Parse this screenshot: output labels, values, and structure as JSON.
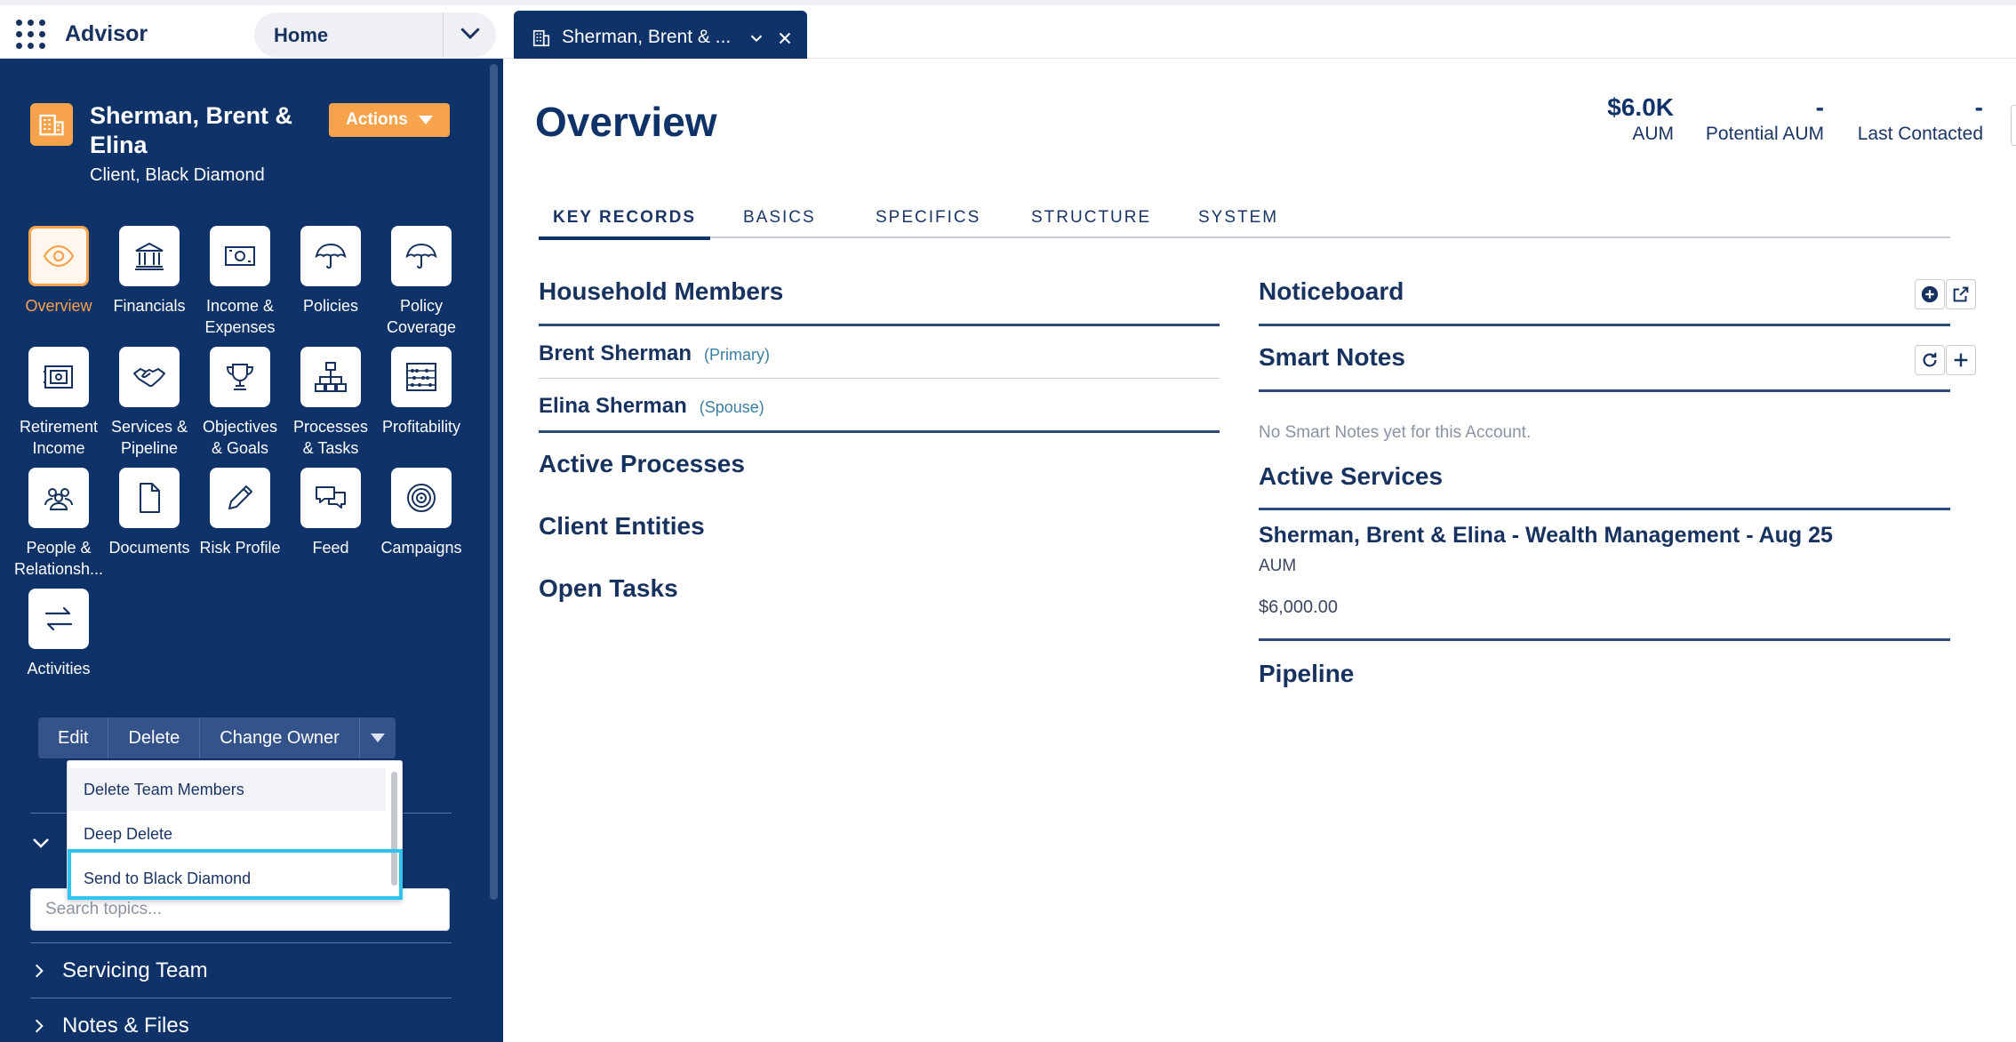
{
  "topbar": {
    "app_name": "Advisor",
    "nav_select": "Home",
    "open_tab": "Sherman, Brent & ..."
  },
  "sidebar": {
    "account_name": "Sherman, Brent & Elina",
    "account_subtitle": "Client, Black Diamond",
    "actions_label": "Actions",
    "tiles": [
      {
        "label": "Overview",
        "icon": "eye-icon"
      },
      {
        "label": "Financials",
        "icon": "bank-icon"
      },
      {
        "label": "Income &\nExpenses",
        "icon": "banknote-icon"
      },
      {
        "label": "Policies",
        "icon": "umbrella-icon"
      },
      {
        "label": "Policy\nCoverage",
        "icon": "umbrella-icon"
      },
      {
        "label": "Retirement\nIncome",
        "icon": "safe-icon"
      },
      {
        "label": "Services &\nPipeline",
        "icon": "handshake-icon"
      },
      {
        "label": "Objectives\n& Goals",
        "icon": "trophy-icon"
      },
      {
        "label": "Processes\n& Tasks",
        "icon": "org-chart-icon"
      },
      {
        "label": "Profitability",
        "icon": "abacus-icon"
      },
      {
        "label": "People &\nRelationsh...",
        "icon": "people-icon"
      },
      {
        "label": "Documents",
        "icon": "document-icon"
      },
      {
        "label": "Risk Profile",
        "icon": "pencil-icon"
      },
      {
        "label": "Feed",
        "icon": "chat-icon"
      },
      {
        "label": "Campaigns",
        "icon": "target-icon"
      },
      {
        "label": "Activities",
        "icon": "swap-arrows-icon"
      }
    ],
    "buttons": {
      "edit": "Edit",
      "delete": "Delete",
      "change_owner": "Change Owner"
    },
    "dropdown_items": [
      "Delete Team Members",
      "Deep Delete",
      "Send to Black Diamond"
    ],
    "topic_search_placeholder": "Search topics...",
    "sections": [
      "Servicing Team",
      "Notes & Files"
    ]
  },
  "main": {
    "title": "Overview",
    "kpis": [
      {
        "value": "$6.0K",
        "label": "AUM"
      },
      {
        "value": "-",
        "label": "Potential AUM"
      },
      {
        "value": "-",
        "label": "Last Contacted"
      }
    ],
    "tabs": [
      "KEY RECORDS",
      "BASICS",
      "SPECIFICS",
      "STRUCTURE",
      "SYSTEM"
    ],
    "left_sections": {
      "household": "Household Members",
      "members": [
        {
          "name": "Brent Sherman",
          "role": "(Primary)"
        },
        {
          "name": "Elina Sherman",
          "role": "(Spouse)"
        }
      ],
      "active_processes": "Active Processes",
      "client_entities": "Client Entities",
      "open_tasks": "Open Tasks"
    },
    "right_sections": {
      "noticeboard": "Noticeboard",
      "smart_notes": "Smart Notes",
      "smart_notes_empty": "No Smart Notes yet for this Account.",
      "active_services": "Active Services",
      "service_title": "Sherman, Brent & Elina - Wealth Management - Aug 25",
      "service_type": "AUM",
      "service_value": "$6,000.00",
      "pipeline": "Pipeline"
    }
  },
  "colors": {
    "navy": "#0f3268",
    "orange": "#f7a34b",
    "focus": "#2dc4ee"
  }
}
